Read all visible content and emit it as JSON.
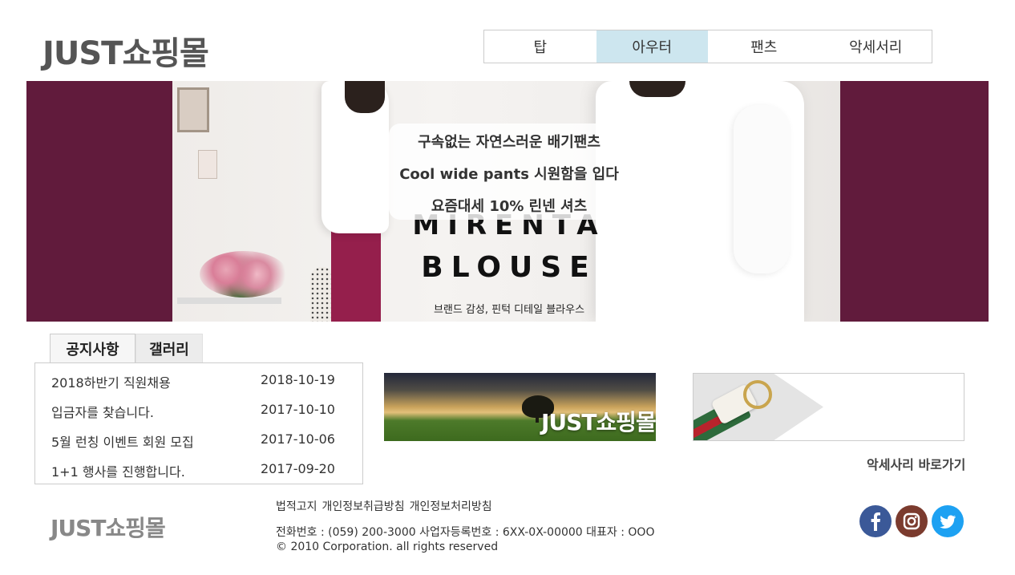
{
  "header": {
    "logo": "JUST쇼핑몰"
  },
  "nav": {
    "items": [
      {
        "label": "탑"
      },
      {
        "label": "아우터"
      },
      {
        "label": "팬츠"
      },
      {
        "label": "악세서리"
      }
    ],
    "active": "아우터"
  },
  "hero": {
    "line1": "구속없는 자연스러운 배기팬츠",
    "line2": "Cool wide pants 시원함을 입다",
    "line3": "요즘대세 10% 린넨 셔츠",
    "brand1": "MIRENTA",
    "brand2": "BLOUSE",
    "subtitle": "브랜드 감성, 핀턱 디테일 블라우스",
    "side_color": "#611b3c"
  },
  "tabs": {
    "notice": "공지사항",
    "gallery": "갤러리"
  },
  "notices": [
    {
      "title": "2018하반기 직원채용",
      "date": "2018-10-19"
    },
    {
      "title": "입금자를 찾습니다.",
      "date": "2017-10-10"
    },
    {
      "title": "5월 런칭 이벤트 회원 모집",
      "date": "2017-10-06"
    },
    {
      "title": "1+1 행사를 진행합니다.",
      "date": "2017-09-20"
    }
  ],
  "banner": {
    "text": "JUST쇼핑몰"
  },
  "accessory": {
    "link": "악세사리 바로가기"
  },
  "footer": {
    "logo": "JUST쇼핑몰",
    "links": [
      "법적고지",
      "개인정보취급방침",
      "개인정보처리방침"
    ],
    "info": "전화번호 : (059) 200-3000 사업자등록번호 : 6XX-0X-00000 대표자 : OOO",
    "copyright": "© 2010 Corporation. all rights reserved"
  },
  "social": [
    {
      "icon": "facebook-icon",
      "color": "#3b5998"
    },
    {
      "icon": "instagram-icon",
      "color": "#7b3b2e"
    },
    {
      "icon": "twitter-icon",
      "color": "#1da1f2"
    }
  ],
  "colors": {
    "nav_active": "#cde6ef"
  }
}
